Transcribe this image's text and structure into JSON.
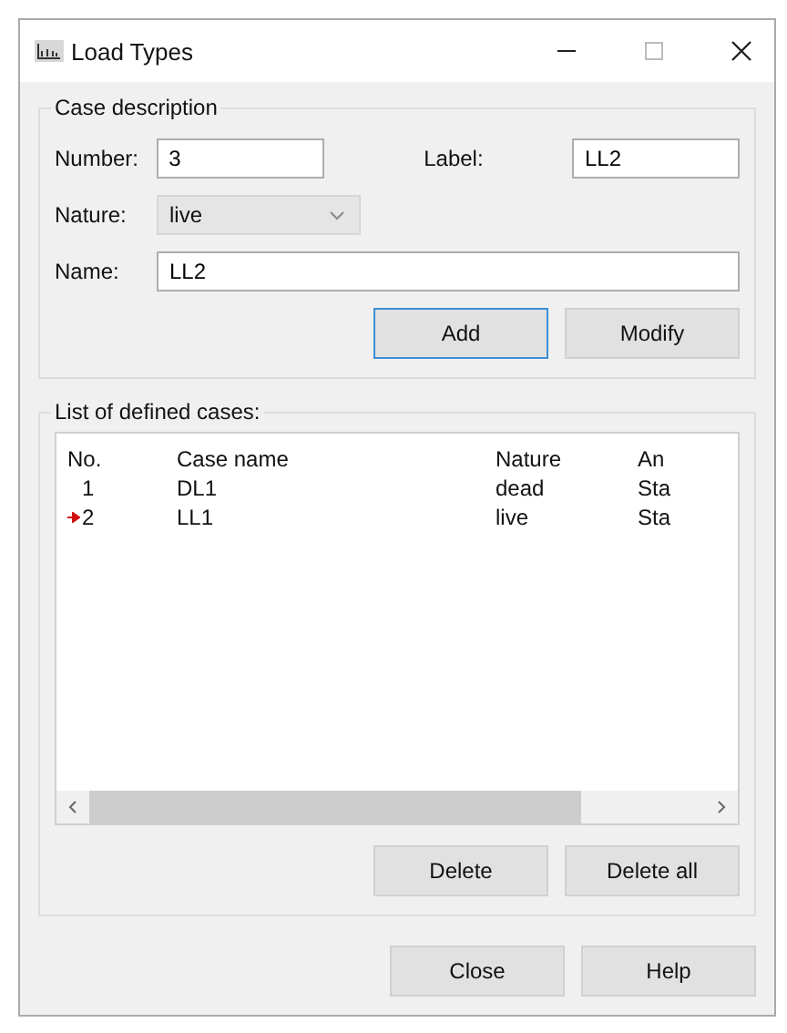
{
  "window": {
    "title": "Load Types"
  },
  "case_description": {
    "title": "Case description",
    "number": {
      "label": "Number:",
      "value": "3"
    },
    "label": {
      "label": "Label:",
      "value": "LL2"
    },
    "nature": {
      "label": "Nature:",
      "value": "live"
    },
    "name": {
      "label": "Name:",
      "value": "LL2"
    },
    "buttons": [
      {
        "label": "Add",
        "focused": true
      },
      {
        "label": "Modify",
        "focused": false
      }
    ]
  },
  "cases": {
    "title": "List of defined cases:",
    "columns": [
      "No.",
      "Case name",
      "Nature",
      "An"
    ],
    "rows": [
      {
        "cells": [
          "1",
          "DL1",
          "dead",
          "Sta"
        ],
        "current": false
      },
      {
        "cells": [
          "2",
          "LL1",
          "live",
          "Sta"
        ],
        "current": true
      }
    ],
    "buttons": [
      "Delete",
      "Delete all"
    ]
  },
  "footer_buttons": [
    "Close",
    "Help"
  ]
}
